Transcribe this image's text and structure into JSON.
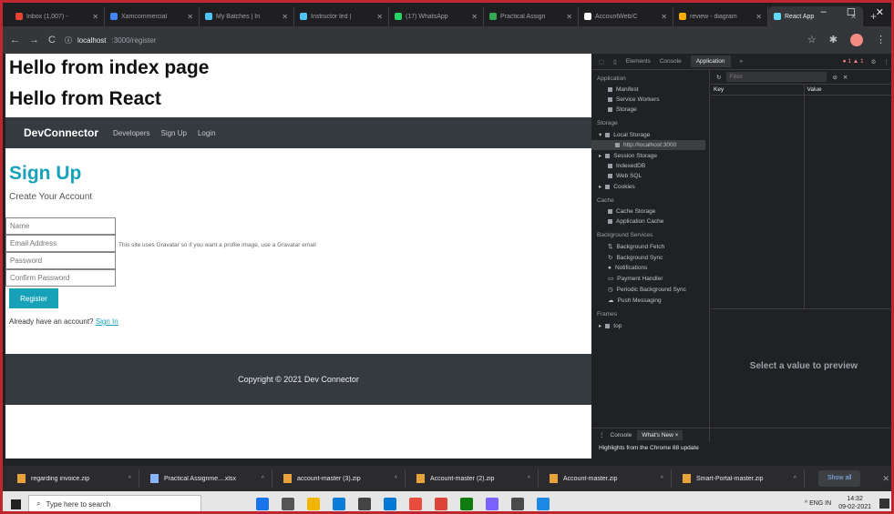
{
  "browser": {
    "tabs": [
      {
        "title": "Inbox (1,007) -",
        "color": "#ea4335"
      },
      {
        "title": "Xamcommercial",
        "color": "#4285f4"
      },
      {
        "title": "My Batches | In",
        "color": "#4fc3f7"
      },
      {
        "title": "Instructor led |",
        "color": "#4fc3f7"
      },
      {
        "title": "(17) WhatsApp",
        "color": "#25d366"
      },
      {
        "title": "Practical Assign",
        "color": "#34a853"
      },
      {
        "title": "AccountWeb/C",
        "color": "#ffffff"
      },
      {
        "title": "review - diagram",
        "color": "#f9ab00"
      },
      {
        "title": "React App",
        "color": "#61dafb",
        "active": true
      }
    ],
    "new_tab": "+",
    "window_controls": [
      "–",
      "☐",
      "✕"
    ],
    "url_host": "localhost",
    "url_path": ":3000/register",
    "nav_buttons": [
      "←",
      "→",
      "C"
    ]
  },
  "page": {
    "h_index": "Hello from index page",
    "h_react": "Hello from React",
    "navbar": {
      "brand": "DevConnector",
      "links": [
        "Developers",
        "Sign Up",
        "Login"
      ]
    },
    "title": "Sign Up",
    "lead": "Create Your Account",
    "fields": {
      "name": "Name",
      "email": "Email Address",
      "password": "Password",
      "confirm": "Confirm Password"
    },
    "email_hint": "This site uses Gravatar so if you want a profile image, use a Gravatar email",
    "register": "Register",
    "already_text": "Already have an account?",
    "signin": "Sign In",
    "footer": "Copyright © 2021 Dev Connector"
  },
  "devtools": {
    "tabs": [
      "Elements",
      "Console",
      "Application",
      "»"
    ],
    "selected_tab": "Application",
    "badge": "● 1 ▲ 1",
    "sections": {
      "application": {
        "label": "Application",
        "items": [
          "Manifest",
          "Service Workers",
          "Storage"
        ]
      },
      "storage": {
        "label": "Storage",
        "local": "Local Storage",
        "local_origin": "http://localhost:3000",
        "items": [
          "Session Storage",
          "IndexedDB",
          "Web SQL",
          "Cookies"
        ]
      },
      "cache": {
        "label": "Cache",
        "items": [
          "Cache Storage",
          "Application Cache"
        ]
      },
      "background": {
        "label": "Background Services",
        "items": [
          "Background Fetch",
          "Background Sync",
          "Notifications",
          "Payment Handler",
          "Periodic Background Sync",
          "Push Messaging"
        ]
      },
      "frames": {
        "label": "Frames",
        "items": [
          "top"
        ]
      }
    },
    "filter_placeholder": "Filter",
    "columns": {
      "key": "Key",
      "value": "Value"
    },
    "preview": "Select a value to preview",
    "drawer": {
      "tabs": [
        "Console",
        "What's New ×"
      ],
      "highlight": "Highlights from the Chrome 88 update"
    }
  },
  "downloads": {
    "items": [
      {
        "name": "regarding invoice.zip",
        "type": "zip"
      },
      {
        "name": "Practical Assignme....xlsx",
        "type": "doc"
      },
      {
        "name": "account-master (3).zip",
        "type": "zip"
      },
      {
        "name": "Account-master (2).zip",
        "type": "zip"
      },
      {
        "name": "Account-master.zip",
        "type": "zip"
      },
      {
        "name": "Smart-Portal-master.zip",
        "type": "zip"
      }
    ],
    "chevron": "^",
    "show_all": "Show all"
  },
  "taskbar": {
    "search_placeholder": "Type here to search",
    "apps": [
      "#1a73e8",
      "#555",
      "#f4b400",
      "#0a7dd8",
      "#444",
      "#0078d4",
      "#e74c3c",
      "#db4437",
      "#107c10",
      "#7b61ff",
      "#4a4a4a",
      "#1e88e5"
    ],
    "tray_text": "^  ENG  IN",
    "time": "14:32",
    "date": "09-02-2021"
  }
}
